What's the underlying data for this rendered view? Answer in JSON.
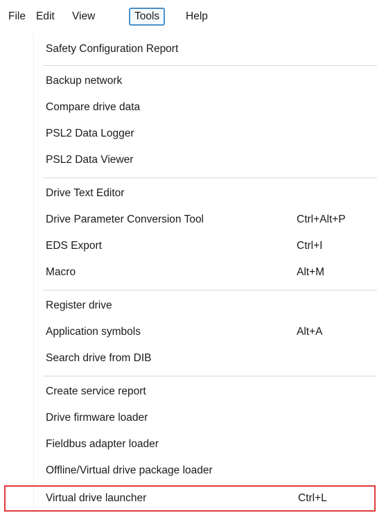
{
  "menubar": {
    "items": [
      {
        "label": "File"
      },
      {
        "label": "Edit"
      },
      {
        "label": "View"
      },
      {
        "label": "Tools",
        "active": true
      },
      {
        "label": "Help"
      }
    ]
  },
  "tools_menu": {
    "groups": [
      [
        {
          "label": "Safety Configuration Report",
          "shortcut": ""
        }
      ],
      [
        {
          "label": "Backup network",
          "shortcut": ""
        },
        {
          "label": "Compare drive data",
          "shortcut": ""
        },
        {
          "label": "PSL2 Data Logger",
          "shortcut": ""
        },
        {
          "label": "PSL2 Data Viewer",
          "shortcut": ""
        }
      ],
      [
        {
          "label": "Drive Text Editor",
          "shortcut": ""
        },
        {
          "label": "Drive Parameter Conversion Tool",
          "shortcut": "Ctrl+Alt+P"
        },
        {
          "label": "EDS Export",
          "shortcut": "Ctrl+I"
        },
        {
          "label": "Macro",
          "shortcut": "Alt+M"
        }
      ],
      [
        {
          "label": "Register drive",
          "shortcut": ""
        },
        {
          "label": "Application symbols",
          "shortcut": "Alt+A"
        },
        {
          "label": "Search drive from DIB",
          "shortcut": ""
        }
      ],
      [
        {
          "label": "Create service report",
          "shortcut": ""
        },
        {
          "label": "Drive firmware loader",
          "shortcut": ""
        },
        {
          "label": "Fieldbus adapter loader",
          "shortcut": ""
        },
        {
          "label": "Offline/Virtual drive package loader",
          "shortcut": ""
        },
        {
          "label": "Virtual drive launcher",
          "shortcut": "Ctrl+L",
          "highlighted": true
        }
      ]
    ]
  },
  "colors": {
    "active_border": "#4a90c9",
    "highlight_border": "#e03a3a",
    "separator": "#d8d8d8"
  }
}
